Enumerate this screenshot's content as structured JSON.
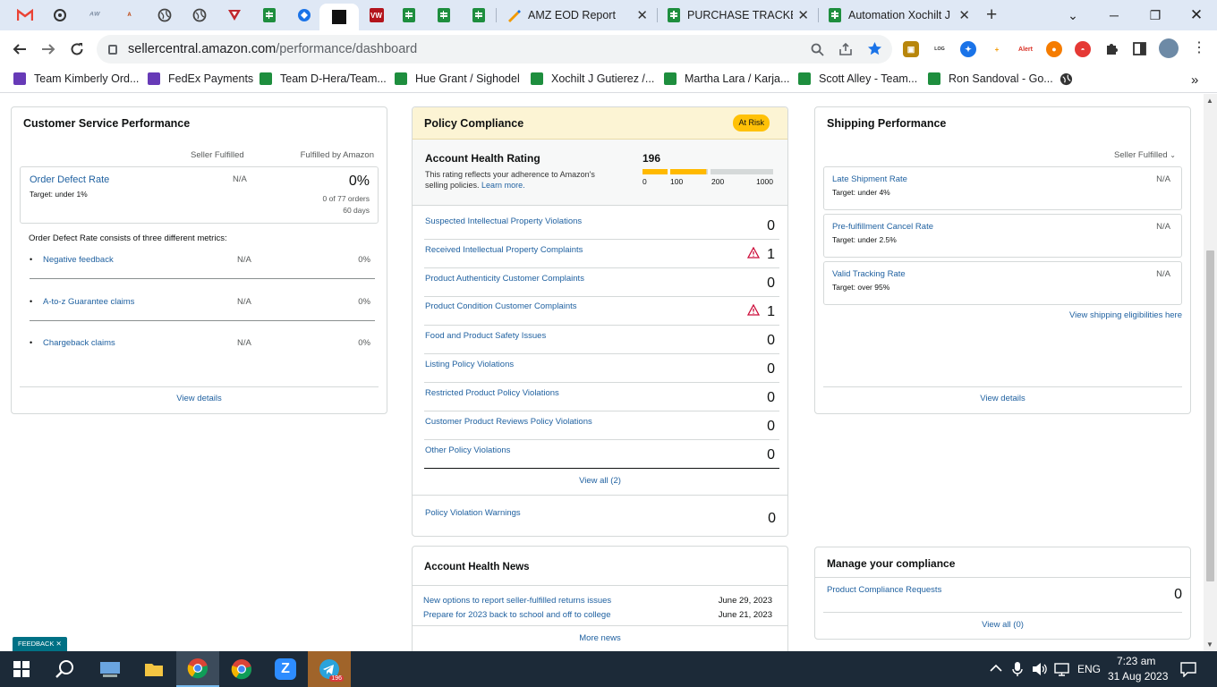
{
  "browser": {
    "tabs": [
      {
        "icon": "gmail-icon"
      },
      {
        "icon": "openai-icon"
      },
      {
        "icon": "tab-icon"
      },
      {
        "icon": "tab-icon"
      },
      {
        "icon": "globe-icon"
      },
      {
        "icon": "globe-icon"
      },
      {
        "icon": "tab-icon"
      },
      {
        "icon": "sheets-icon"
      },
      {
        "icon": "tab-icon"
      },
      {
        "icon": "amazon-icon"
      },
      {
        "icon": "tab-icon"
      },
      {
        "icon": "sheets-icon"
      },
      {
        "icon": "sheets-icon"
      },
      {
        "icon": "sheets-icon"
      }
    ],
    "named_tabs": [
      {
        "title": "AMZ EOD Report",
        "close": "✕"
      },
      {
        "title": "PURCHASE TRACKER",
        "close": "✕"
      },
      {
        "title": "Automation Xochilt J",
        "close": "✕"
      }
    ],
    "new_tab": "+",
    "url_host": "sellercentral.amazon.com",
    "url_path": "/performance/dashboard",
    "bookmarks": [
      "Team Kimberly Ord...",
      "FedEx Payments",
      "Team D-Hera/Team...",
      "Hue Grant / Sighodel",
      "Xochilt J Gutierez /...",
      "Martha Lara / Karja...",
      "Scott Alley - Team...",
      "Ron Sandoval - Go..."
    ],
    "bookmarks_more": "»"
  },
  "customer_service": {
    "title": "Customer Service Performance",
    "col_seller": "Seller Fulfilled",
    "col_fba": "Fulfilled by Amazon",
    "odr": {
      "label": "Order Defect Rate",
      "target": "Target: under 1%",
      "seller_value": "N/A",
      "fba_value": "0%",
      "orders": "0 of 77 orders",
      "days": "60 days"
    },
    "metrics_intro": "Order Defect Rate consists of three different metrics:",
    "metrics": [
      {
        "label": "Negative feedback",
        "seller": "N/A",
        "fba": "0%"
      },
      {
        "label": "A-to-z Guarantee claims",
        "seller": "N/A",
        "fba": "0%"
      },
      {
        "label": "Chargeback claims",
        "seller": "N/A",
        "fba": "0%"
      }
    ],
    "view_details": "View details"
  },
  "policy_compliance": {
    "title": "Policy Compliance",
    "badge": "At Risk",
    "ahr_title": "Account Health Rating",
    "ahr_value": "196",
    "ahr_progress": 196,
    "ahr_desc": "This rating reflects your adherence to Amazon's selling policies.",
    "ahr_learn_more": "Learn more.",
    "scale": [
      "0",
      "100",
      "200",
      "1000"
    ],
    "rows": [
      {
        "label": "Suspected Intellectual Property Violations",
        "value": "0",
        "warn": false
      },
      {
        "label": "Received Intellectual Property Complaints",
        "value": "1",
        "warn": true
      },
      {
        "label": "Product Authenticity Customer Complaints",
        "value": "0",
        "warn": false
      },
      {
        "label": "Product Condition Customer Complaints",
        "value": "1",
        "warn": true
      },
      {
        "label": "Food and Product Safety Issues",
        "value": "0",
        "warn": false
      },
      {
        "label": "Listing Policy Violations",
        "value": "0",
        "warn": false
      },
      {
        "label": "Restricted Product Policy Violations",
        "value": "0",
        "warn": false
      },
      {
        "label": "Customer Product Reviews Policy Violations",
        "value": "0",
        "warn": false
      },
      {
        "label": "Other Policy Violations",
        "value": "0",
        "warn": false
      }
    ],
    "view_all": "View all (2)",
    "warnings_label": "Policy Violation Warnings",
    "warnings_value": "0"
  },
  "news": {
    "title": "Account Health News",
    "items": [
      {
        "label": "New options to report seller-fulfilled returns issues",
        "date": "June 29, 2023"
      },
      {
        "label": "Prepare for 2023 back to school and off to college",
        "date": "June 21, 2023"
      }
    ],
    "more": "More news"
  },
  "shipping": {
    "title": "Shipping Performance",
    "filter": "Seller Fulfilled",
    "metrics": [
      {
        "label": "Late Shipment Rate",
        "target": "Target: under 4%",
        "value": "N/A"
      },
      {
        "label": "Pre-fulfillment Cancel Rate",
        "target": "Target: under 2.5%",
        "value": "N/A"
      },
      {
        "label": "Valid Tracking Rate",
        "target": "Target: over 95%",
        "value": "N/A"
      }
    ],
    "eligibility": "View shipping eligibilities here",
    "view_details": "View details"
  },
  "manage": {
    "title": "Manage your compliance",
    "row_label": "Product Compliance Requests",
    "row_value": "0",
    "view_all": "View all (0)"
  },
  "feedback": "FEEDBACK",
  "feedback_close": "✕",
  "taskbar": {
    "time": "7:23 am",
    "date": "31 Aug 2023",
    "lang": "ENG",
    "telegram_badge": "196"
  }
}
